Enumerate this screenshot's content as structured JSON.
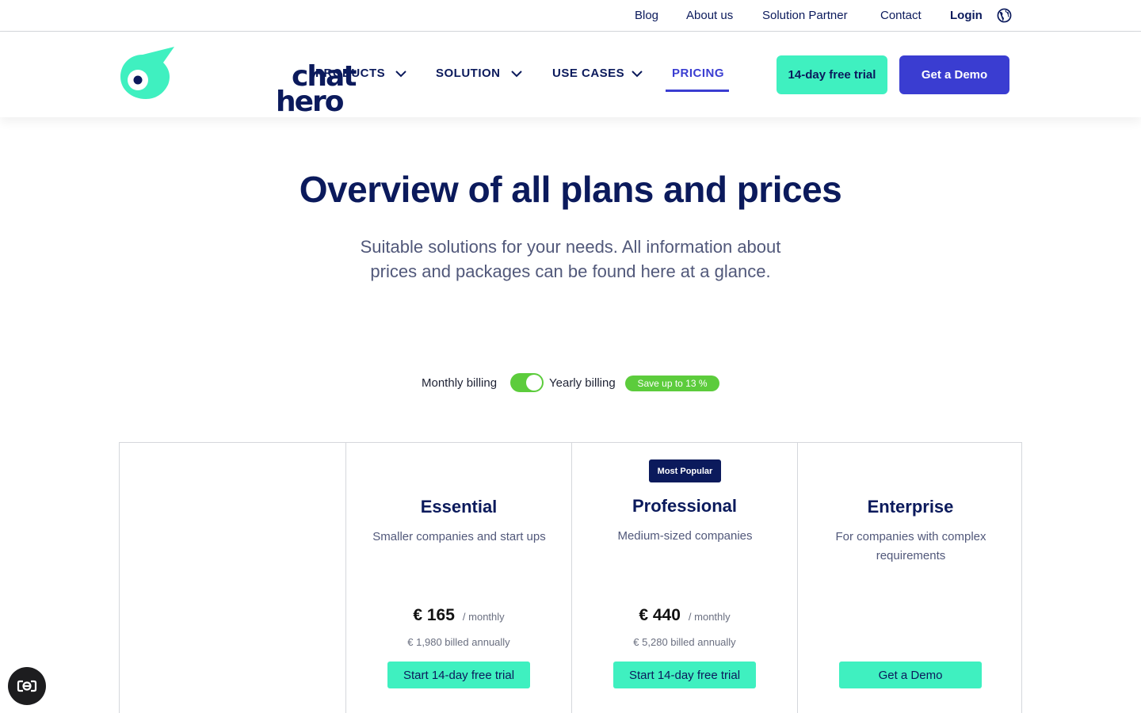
{
  "topbar": {
    "links": [
      "Blog",
      "About us",
      "Solution Partner",
      "Contact"
    ],
    "login": "Login",
    "language_icon": "globe-icon"
  },
  "brand": {
    "name_top": "chat",
    "name_bottom": "hero",
    "mint": "#3ff0c0",
    "navy": "#0b1a5c",
    "accent": "#3a3dd1"
  },
  "nav": {
    "items": [
      {
        "label": "PRODUCTS",
        "dropdown": true
      },
      {
        "label": "SOLUTION",
        "dropdown": true
      },
      {
        "label": "USE CASES",
        "dropdown": true
      },
      {
        "label": "PRICING",
        "active": true
      }
    ],
    "trial_button": "14-day free trial",
    "demo_button": "Get a Demo"
  },
  "hero": {
    "title": "Overview of all plans and prices",
    "subtitle": "Suitable solutions for your needs. All information about prices and packages can be found here at a glance."
  },
  "billing": {
    "monthly_label": "Monthly billing",
    "yearly_label": "Yearly billing",
    "yearly_selected": true,
    "save_badge": "Save up to 13 %",
    "toggle_color": "#5ccc3c"
  },
  "plans": [
    {
      "name": "Essential",
      "description": "Smaller companies and start ups",
      "price": "€ 165",
      "period": "/ monthly",
      "billed": "€ 1,980 billed annually",
      "button": "Start 14-day free trial"
    },
    {
      "name": "Professional",
      "badge": "Most Popular",
      "description": "Medium-sized companies",
      "price": "€ 440",
      "period": "/ monthly",
      "billed": "€ 5,280 billed annually",
      "button": "Start 14-day free trial"
    },
    {
      "name": "Enterprise",
      "description": "For companies with complex requirements",
      "button": "Get a Demo"
    }
  ],
  "chat_widget": {
    "icon": "chat-widget-icon"
  }
}
